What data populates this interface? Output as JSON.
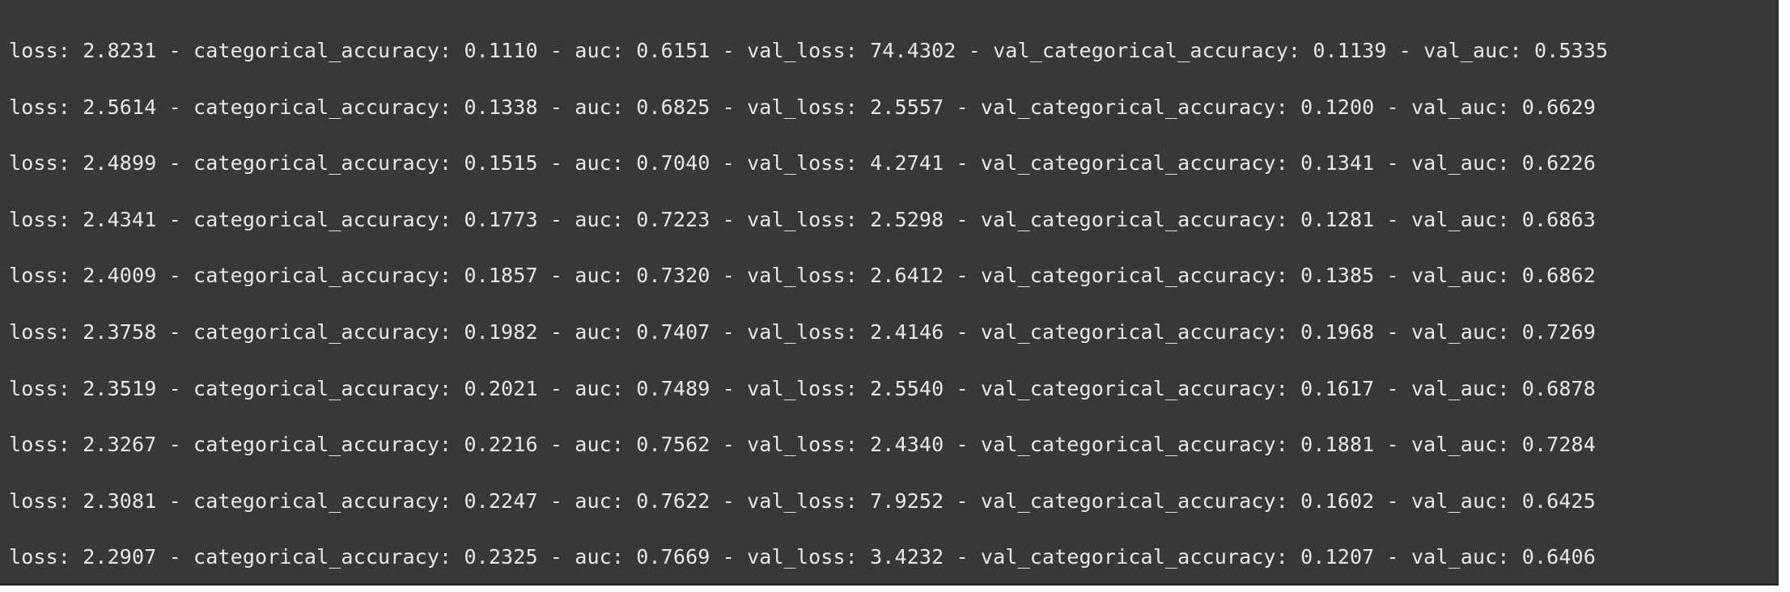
{
  "console": {
    "lines": [
      "loss: 2.8231 - categorical_accuracy: 0.1110 - auc: 0.6151 - val_loss: 74.4302 - val_categorical_accuracy: 0.1139 - val_auc: 0.5335",
      "loss: 2.5614 - categorical_accuracy: 0.1338 - auc: 0.6825 - val_loss: 2.5557 - val_categorical_accuracy: 0.1200 - val_auc: 0.6629",
      "loss: 2.4899 - categorical_accuracy: 0.1515 - auc: 0.7040 - val_loss: 4.2741 - val_categorical_accuracy: 0.1341 - val_auc: 0.6226",
      "loss: 2.4341 - categorical_accuracy: 0.1773 - auc: 0.7223 - val_loss: 2.5298 - val_categorical_accuracy: 0.1281 - val_auc: 0.6863",
      "loss: 2.4009 - categorical_accuracy: 0.1857 - auc: 0.7320 - val_loss: 2.6412 - val_categorical_accuracy: 0.1385 - val_auc: 0.6862",
      "loss: 2.3758 - categorical_accuracy: 0.1982 - auc: 0.7407 - val_loss: 2.4146 - val_categorical_accuracy: 0.1968 - val_auc: 0.7269",
      "loss: 2.3519 - categorical_accuracy: 0.2021 - auc: 0.7489 - val_loss: 2.5540 - val_categorical_accuracy: 0.1617 - val_auc: 0.6878",
      "loss: 2.3267 - categorical_accuracy: 0.2216 - auc: 0.7562 - val_loss: 2.4340 - val_categorical_accuracy: 0.1881 - val_auc: 0.7284",
      "loss: 2.3081 - categorical_accuracy: 0.2247 - auc: 0.7622 - val_loss: 7.9252 - val_categorical_accuracy: 0.1602 - val_auc: 0.6425",
      "loss: 2.2907 - categorical_accuracy: 0.2325 - auc: 0.7669 - val_loss: 3.4232 - val_categorical_accuracy: 0.1207 - val_auc: 0.6406"
    ]
  },
  "colors": {
    "background": "#383838",
    "text": "#e8e8e8"
  }
}
